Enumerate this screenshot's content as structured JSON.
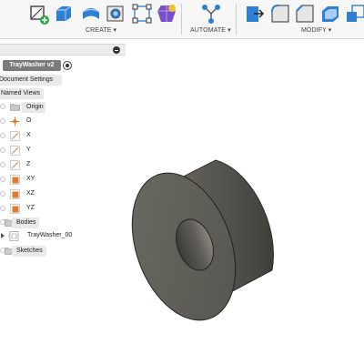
{
  "toolbar": {
    "groups": [
      {
        "label": "CREATE ▾"
      },
      {
        "label": "AUTOMATE ▾"
      },
      {
        "label": "MODIFY ▾"
      }
    ],
    "icons": [
      "sketch-icon",
      "extrude-icon",
      "revolve-icon",
      "hole-icon",
      "pattern-icon",
      "form-icon",
      "automate-icon",
      "press-pull-icon",
      "fillet-icon",
      "chamfer-icon",
      "shell-icon",
      "scale-icon"
    ]
  },
  "browser": {
    "root": "TrayWasher v2",
    "document_settings": "Document Settings",
    "named_views": "Named Views",
    "origin": {
      "label": "Origin",
      "items": [
        "O",
        "X",
        "Y",
        "Z",
        "XY",
        "XZ",
        "YZ"
      ]
    },
    "bodies": {
      "label": "Bodies",
      "items": [
        "TrayWasher_00"
      ]
    },
    "sketches": "Sketches"
  },
  "colors": {
    "accent_blue": "#1e6fd1",
    "plane_orange": "#e07a2e",
    "body_gray": "#5c5c55"
  }
}
